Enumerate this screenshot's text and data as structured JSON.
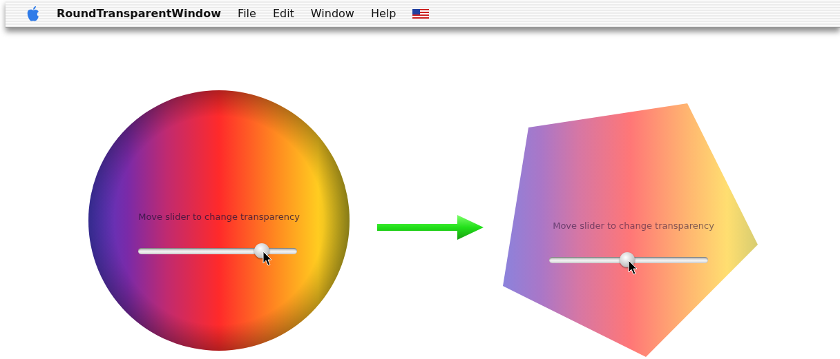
{
  "menu_bar": {
    "app_name": "RoundTransparentWindow",
    "items": [
      "File",
      "Edit",
      "Window",
      "Help"
    ]
  },
  "windows": [
    {
      "kind": "circle",
      "label": "Move slider to change transparency",
      "level": 0.78
    },
    {
      "kind": "pentagon",
      "label": "Move slider to change transparency",
      "level": 0.49
    }
  ]
}
